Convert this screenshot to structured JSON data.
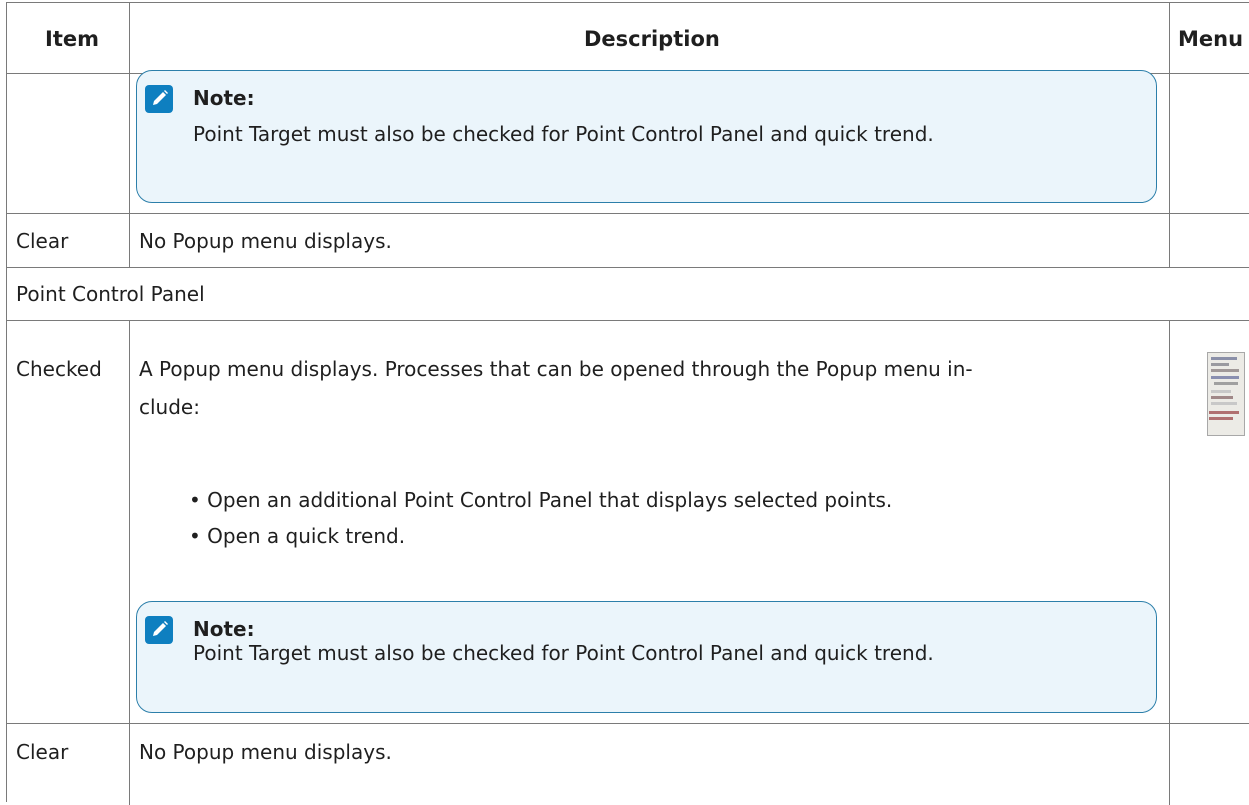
{
  "table": {
    "headers": {
      "item": "Item",
      "description": "Description",
      "menu": "Menu"
    },
    "note": {
      "title": "Note:",
      "text": "Point Target must also be checked for Point Control Panel and quick trend."
    },
    "rows": {
      "clear_1": {
        "item": "Clear",
        "description": "No Popup menu displays."
      },
      "section": {
        "label": "Point Control Panel"
      },
      "checked": {
        "item": "Checked",
        "description_line1": "A Popup menu displays. Processes that can be opened through the Popup menu in-",
        "description_line2": "clude:",
        "bullets": [
          "Open an additional Point Control Panel that displays selected points.",
          "Open a quick trend."
        ]
      },
      "clear_2": {
        "item": "Clear",
        "description": "No Popup menu displays."
      }
    }
  },
  "icons": {
    "note": "pencil-clipboard-icon",
    "menu_thumbnail": "popup-menu-screenshot-thumbnail"
  },
  "colors": {
    "note_background": "#ebf5fb",
    "note_border": "#2c7faa",
    "note_icon": "#0e7fc0",
    "grid": "#7a7a7a"
  }
}
